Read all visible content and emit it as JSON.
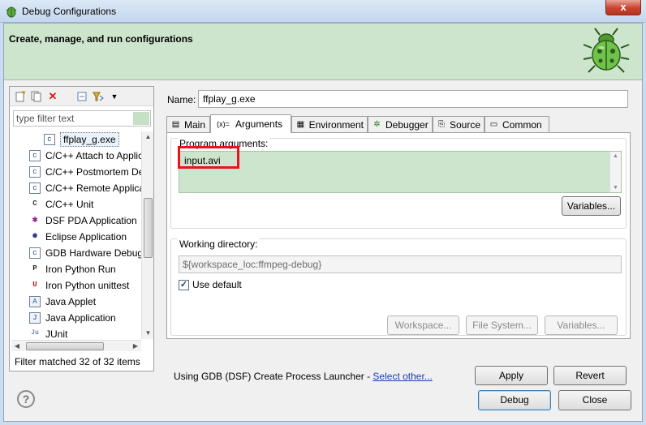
{
  "window": {
    "title": "Debug Configurations",
    "close_label": "x"
  },
  "banner": {
    "heading": "Create, manage, and run configurations",
    "logo": "debug-bug-icon"
  },
  "left": {
    "filter_placeholder": "type filter text",
    "items": [
      {
        "label": "ffplay_g.exe",
        "icon": "c-app-icon",
        "glyph": "c"
      },
      {
        "label": "C/C++ Attach to Application",
        "icon": "c-attach-icon",
        "glyph": "c"
      },
      {
        "label": "C/C++ Postmortem Debugger",
        "icon": "c-postmortem-icon",
        "glyph": "c"
      },
      {
        "label": "C/C++ Remote Application",
        "icon": "c-remote-icon",
        "glyph": "c"
      },
      {
        "label": "C/C++ Unit",
        "icon": "c-unit-icon",
        "glyph": "C"
      },
      {
        "label": "DSF PDA Application",
        "icon": "dsf-pda-icon",
        "glyph": "✱"
      },
      {
        "label": "Eclipse Application",
        "icon": "eclipse-icon",
        "glyph": "●"
      },
      {
        "label": "GDB Hardware Debugging",
        "icon": "gdb-hardware-icon",
        "glyph": "c"
      },
      {
        "label": "Iron Python Run",
        "icon": "iron-python-icon",
        "glyph": "P"
      },
      {
        "label": "Iron Python unittest",
        "icon": "iron-python-unittest-icon",
        "glyph": "U"
      },
      {
        "label": "Java Applet",
        "icon": "java-applet-icon",
        "glyph": "A"
      },
      {
        "label": "Java Application",
        "icon": "java-app-icon",
        "glyph": "J"
      },
      {
        "label": "JUnit",
        "icon": "junit-icon",
        "glyph": "Ju"
      }
    ],
    "status": "Filter matched 32 of 32 items"
  },
  "right": {
    "name_label": "Name:",
    "name_value": "ffplay_g.exe",
    "tabs": [
      {
        "label": "Main",
        "icon": "main-tab-icon",
        "glyph": "▤"
      },
      {
        "label": "Arguments",
        "icon": "arguments-tab-icon",
        "glyph": "(x)="
      },
      {
        "label": "Environment",
        "icon": "environment-tab-icon",
        "glyph": "▦"
      },
      {
        "label": "Debugger",
        "icon": "debugger-tab-icon",
        "glyph": "✲"
      },
      {
        "label": "Source",
        "icon": "source-tab-icon",
        "glyph": "⎘"
      },
      {
        "label": "Common",
        "icon": "common-tab-icon",
        "glyph": "▭"
      }
    ],
    "program_args_label": "Program arguments:",
    "program_args_value": "input.avi",
    "variables_label": "Variables...",
    "working_dir_label": "Working directory:",
    "working_dir_value": "${workspace_loc:ffmpeg-debug}",
    "use_default_label": "Use default",
    "workspace_btn": "Workspace...",
    "file_system_btn": "File System...",
    "variables2_btn": "Variables...",
    "launcher_text": "Using GDB (DSF) Create Process Launcher - ",
    "select_other": "Select other...",
    "apply_label": "Apply",
    "revert_label": "Revert"
  },
  "footer": {
    "debug_label": "Debug",
    "close_label": "Close"
  },
  "colors": {
    "banner": "#cce5cc",
    "args_bg": "#cce5cc",
    "highlight": "#e8131b",
    "link": "#1a3fb0"
  }
}
